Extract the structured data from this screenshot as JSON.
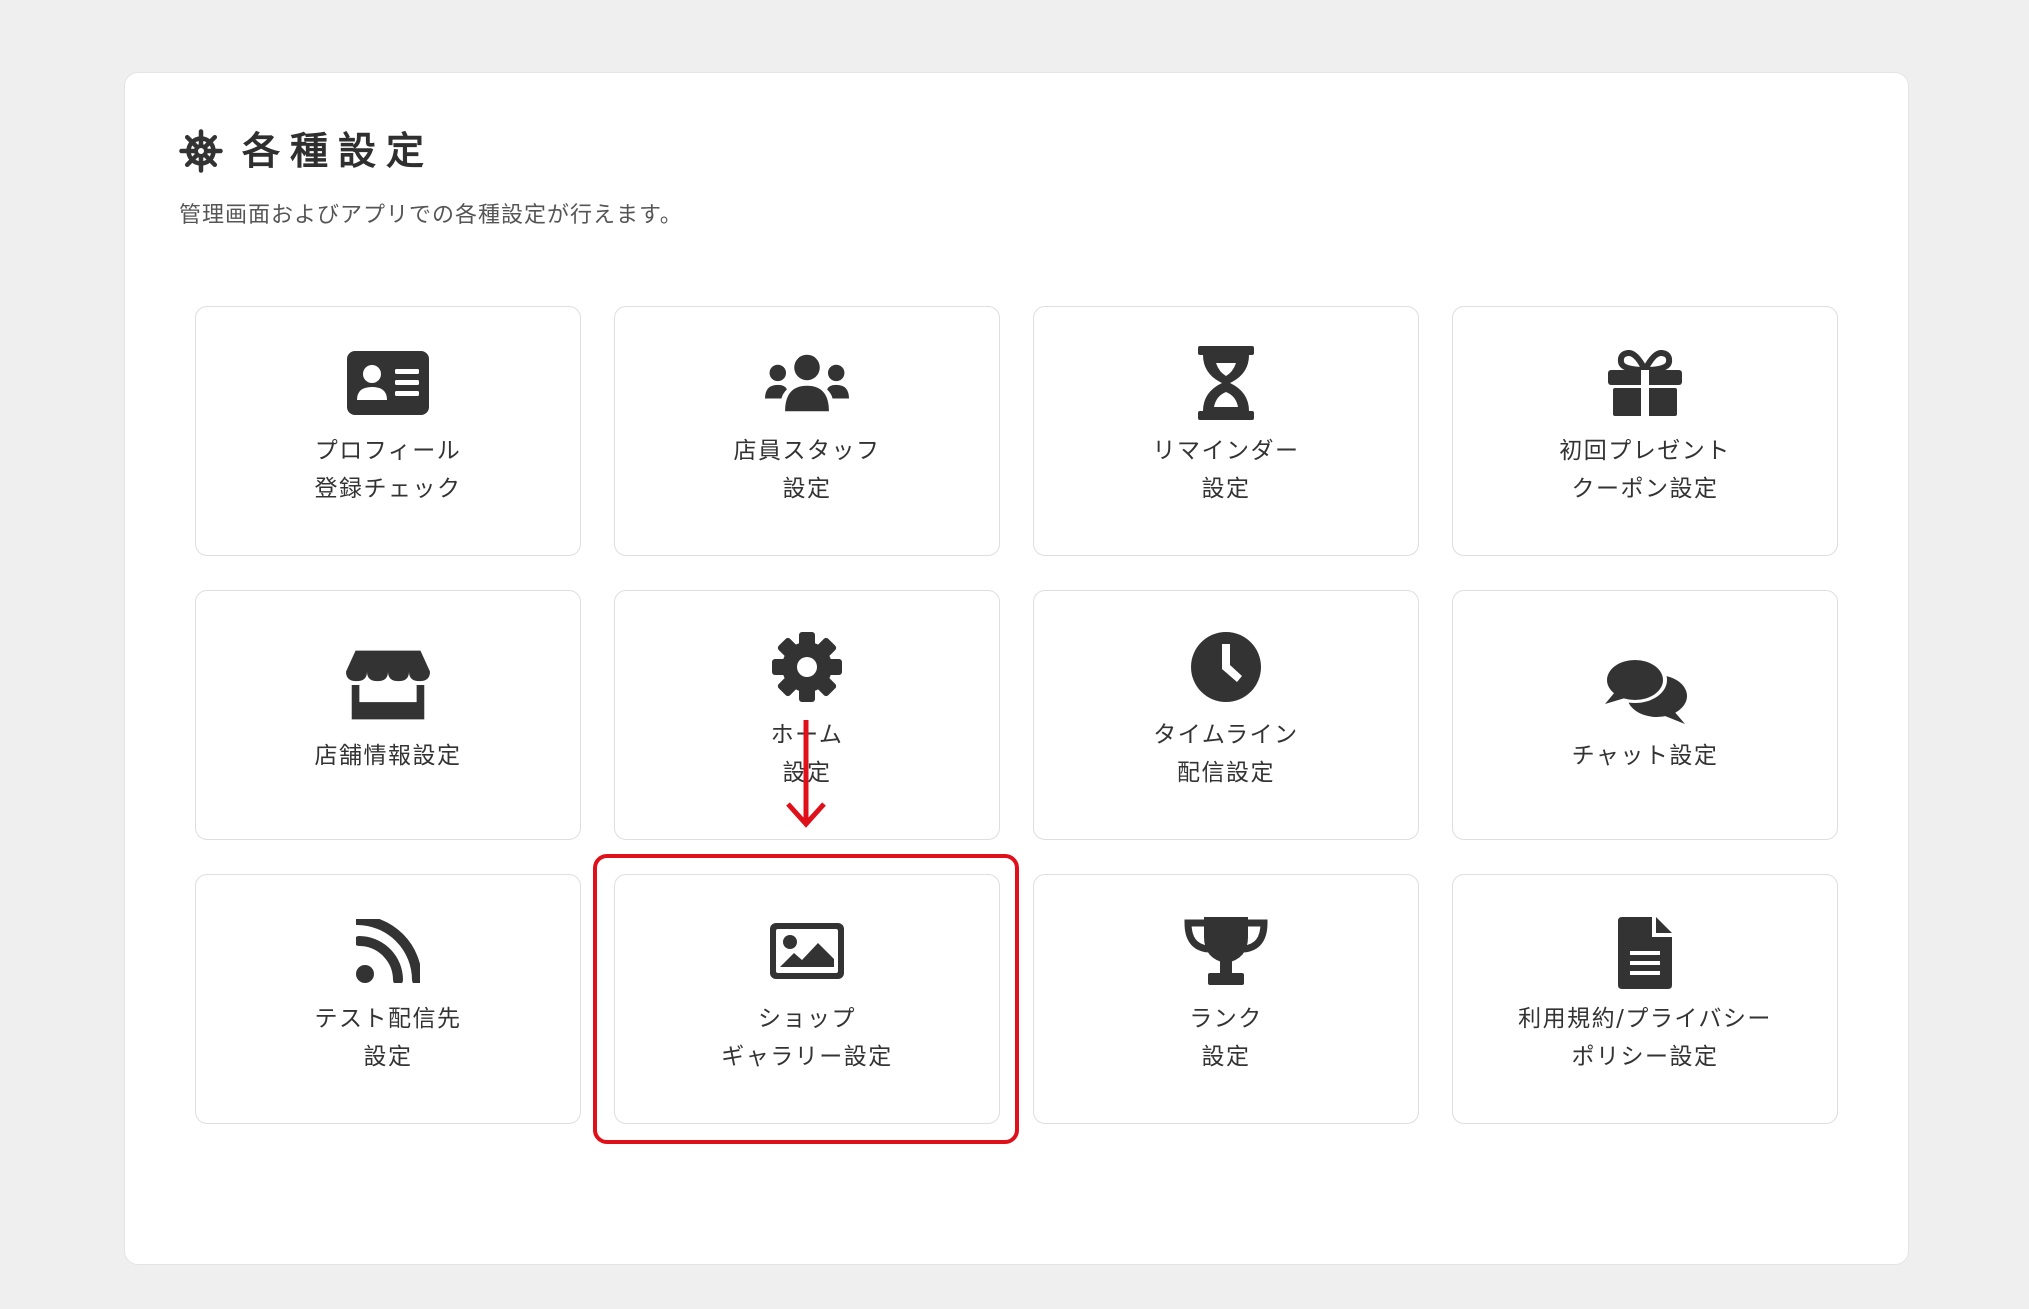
{
  "header": {
    "title": "各種設定",
    "subtitle": "管理画面およびアプリでの各種設定が行えます。",
    "icon": "ship-wheel-icon"
  },
  "tiles": [
    {
      "id": "profile-check",
      "icon": "id-card-icon",
      "lines": [
        "プロフィール",
        "登録チェック"
      ]
    },
    {
      "id": "staff",
      "icon": "users-icon",
      "lines": [
        "店員スタッフ",
        "設定"
      ]
    },
    {
      "id": "reminder",
      "icon": "hourglass-icon",
      "lines": [
        "リマインダー",
        "設定"
      ]
    },
    {
      "id": "first-present",
      "icon": "gift-icon",
      "lines": [
        "初回プレゼント",
        "クーポン設定"
      ]
    },
    {
      "id": "store-info",
      "icon": "store-icon",
      "lines": [
        "店舗情報設定"
      ]
    },
    {
      "id": "home",
      "icon": "gear-icon",
      "lines": [
        "ホーム",
        "設定"
      ]
    },
    {
      "id": "timeline",
      "icon": "clock-icon",
      "lines": [
        "タイムライン",
        "配信設定"
      ]
    },
    {
      "id": "chat",
      "icon": "chat-bubbles-icon",
      "lines": [
        "チャット設定"
      ]
    },
    {
      "id": "test-delivery",
      "icon": "rss-icon",
      "lines": [
        "テスト配信先",
        "設定"
      ]
    },
    {
      "id": "shop-gallery",
      "icon": "image-icon",
      "lines": [
        "ショップ",
        "ギャラリー設定"
      ]
    },
    {
      "id": "rank",
      "icon": "trophy-icon",
      "lines": [
        "ランク",
        "設定"
      ]
    },
    {
      "id": "terms-privacy",
      "icon": "document-icon",
      "lines": [
        "利用規約/プライバシー",
        "ポリシー設定"
      ]
    }
  ],
  "colors": {
    "background": "#efefef",
    "panel": "#ffffff",
    "icon": "#333333",
    "highlight": "#e0101a"
  }
}
